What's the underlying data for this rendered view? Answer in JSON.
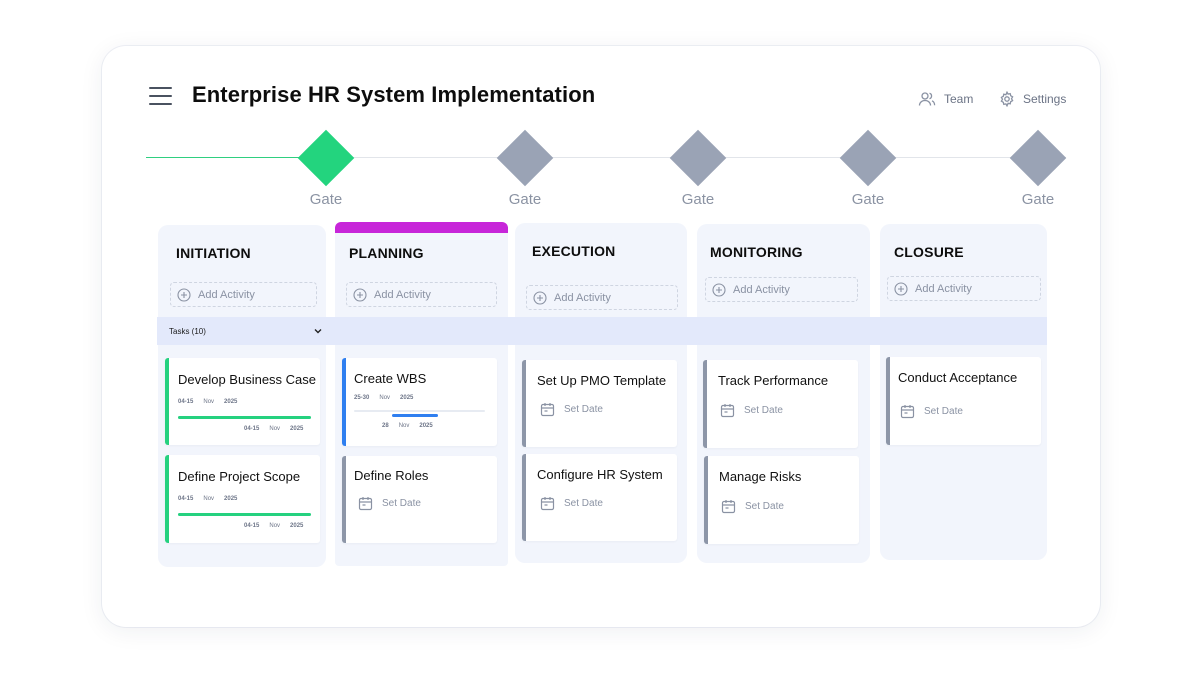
{
  "header": {
    "title": "Enterprise HR System Implementation",
    "team_label": "Team",
    "settings_label": "Settings"
  },
  "gates": [
    {
      "label": "Gate",
      "status": "complete"
    },
    {
      "label": "Gate",
      "status": "pending"
    },
    {
      "label": "Gate",
      "status": "pending"
    },
    {
      "label": "Gate",
      "status": "pending"
    },
    {
      "label": "Gate",
      "status": "pending"
    }
  ],
  "phases": [
    {
      "title": "INITIATION",
      "add_label": "Add Activity"
    },
    {
      "title": "PLANNING",
      "add_label": "Add Activity",
      "selected": true
    },
    {
      "title": "EXECUTION",
      "add_label": "Add Activity"
    },
    {
      "title": "MONITORING",
      "add_label": "Add Activity"
    },
    {
      "title": "CLOSURE",
      "add_label": "Add Activity"
    }
  ],
  "tasks_toggle": {
    "label": "Tasks (10)"
  },
  "tasks": {
    "initiation": [
      {
        "title": "Develop Business Case",
        "start_day": "04-15",
        "start_month": "Nov",
        "start_year": "2025",
        "end_day": "04-15",
        "end_month": "Nov",
        "end_year": "2025",
        "progress": 1.0,
        "accent": "green"
      },
      {
        "title": "Define Project Scope",
        "start_day": "04-15",
        "start_month": "Nov",
        "start_year": "2025",
        "end_day": "04-15",
        "end_month": "Nov",
        "end_year": "2025",
        "progress": 1.0,
        "accent": "green"
      }
    ],
    "planning": [
      {
        "title": "Create WBS",
        "start_day": "25-30",
        "start_month": "Nov",
        "start_year": "2025",
        "end_day": "28",
        "end_month": "Nov",
        "end_year": "2025",
        "progress": 0.35,
        "accent": "blue"
      },
      {
        "title": "Define Roles",
        "set_date_label": "Set Date"
      }
    ],
    "execution": [
      {
        "title": "Set Up PMO Template",
        "set_date_label": "Set Date"
      },
      {
        "title": "Configure HR System",
        "set_date_label": "Set Date"
      }
    ],
    "monitoring": [
      {
        "title": "Track Performance",
        "set_date_label": "Set Date"
      },
      {
        "title": "Manage Risks",
        "set_date_label": "Set Date"
      }
    ],
    "closure": [
      {
        "title": "Conduct Acceptance",
        "set_date_label": "Set Date"
      }
    ]
  },
  "colors": {
    "gate_complete": "#23d47e",
    "gate_pending": "#9aa3b5",
    "selected_phase": "#c726d9",
    "progress_green": "#25d17f",
    "progress_blue": "#2f7ff0"
  },
  "icons": {
    "menu": "hamburger-menu-icon",
    "team": "users-icon",
    "settings": "gear-icon",
    "add": "plus-circle-icon",
    "calendar": "calendar-icon",
    "chevron": "chevron-down-icon"
  }
}
